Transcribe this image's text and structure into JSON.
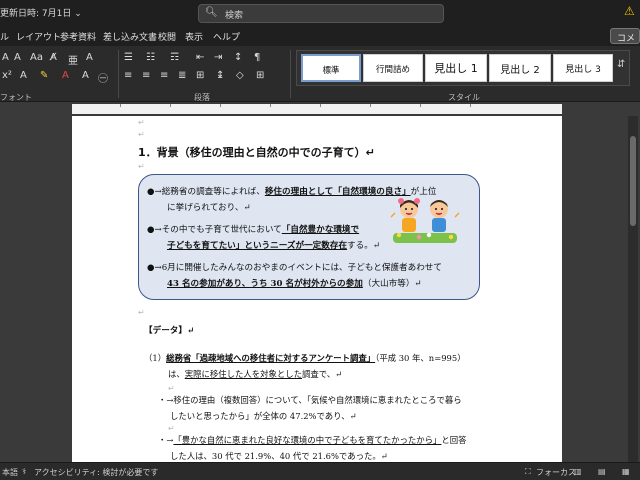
{
  "titlebar": {
    "saved": "更新日時: 7月1日 ⌄",
    "search_placeholder": "検索",
    "search_icon": "search-icon",
    "warn_icon": "warning-icon"
  },
  "menu": [
    "ル",
    "レイアウト",
    "参考資料",
    "差し込み文書",
    "校閲",
    "表示",
    "ヘルプ"
  ],
  "comment_label": "コメ",
  "ribbon": {
    "font_group_label": "フォント",
    "paragraph_group_label": "段落",
    "style_group_label": "スタイル",
    "styles": [
      "標準",
      "行間詰め",
      "見出し 1",
      "見出し 2",
      "見出し 3"
    ]
  },
  "document": {
    "heading": "1．背景（移住の理由と自然の中での子育て）↵",
    "box": {
      "b1_l1_pre": "●→総務省の調査等によれば、",
      "b1_l1_emph": "移住の理由として「自然環境の良さ」",
      "b1_l1_post": "が上位",
      "b1_l2": "に挙げられており、↵",
      "b2_l1_pre": "●→その中でも子育て世代において",
      "b2_l1_emph": "「自然豊かな環境で",
      "b2_l2_emph": "子どもを育てたい」というニーズが一定数存在",
      "b2_l2_post": "する。↵",
      "b3_l1": "●→6月に開催したみんなのおやまのイベントには、子どもと保護者あわせて",
      "b3_l2_emph": "43 名の参加があり、うち 30 名が村外からの参加",
      "b3_l2_post": "（大山市等）↵"
    },
    "data_heading": "【データ】↵",
    "item1_l1_pre": "（1）",
    "item1_l1_emph": "総務省「過疎地域への移住者に対するアンケート調査」",
    "item1_l1_post": "（平成 30 年、n=995）",
    "item1_l2_pre": "は、",
    "item1_l2_emph": "実際に移住した人を対象とした",
    "item1_l2_post": "調査で、↵",
    "bullet1_l1": "・→移住の理由（複数回答）について、「気候や自然環境に恵まれたところで暮ら",
    "bullet1_l2": "したいと思ったから」が全体の 47.2%であり、↵",
    "bullet2_l1_pre": "・→",
    "bullet2_l1_emph": "「豊かな自然に恵まれた良好な環境の中で子どもを育てたかったから」",
    "bullet2_l1_post": "と回答",
    "bullet2_l2": "した人は、30 代で 21.9%、40 代で 21.6%であった。↵"
  },
  "statusbar": {
    "lang": "本語",
    "accessibility": "アクセシビリティ: 検討が必要です",
    "focus": "フォーカス"
  }
}
